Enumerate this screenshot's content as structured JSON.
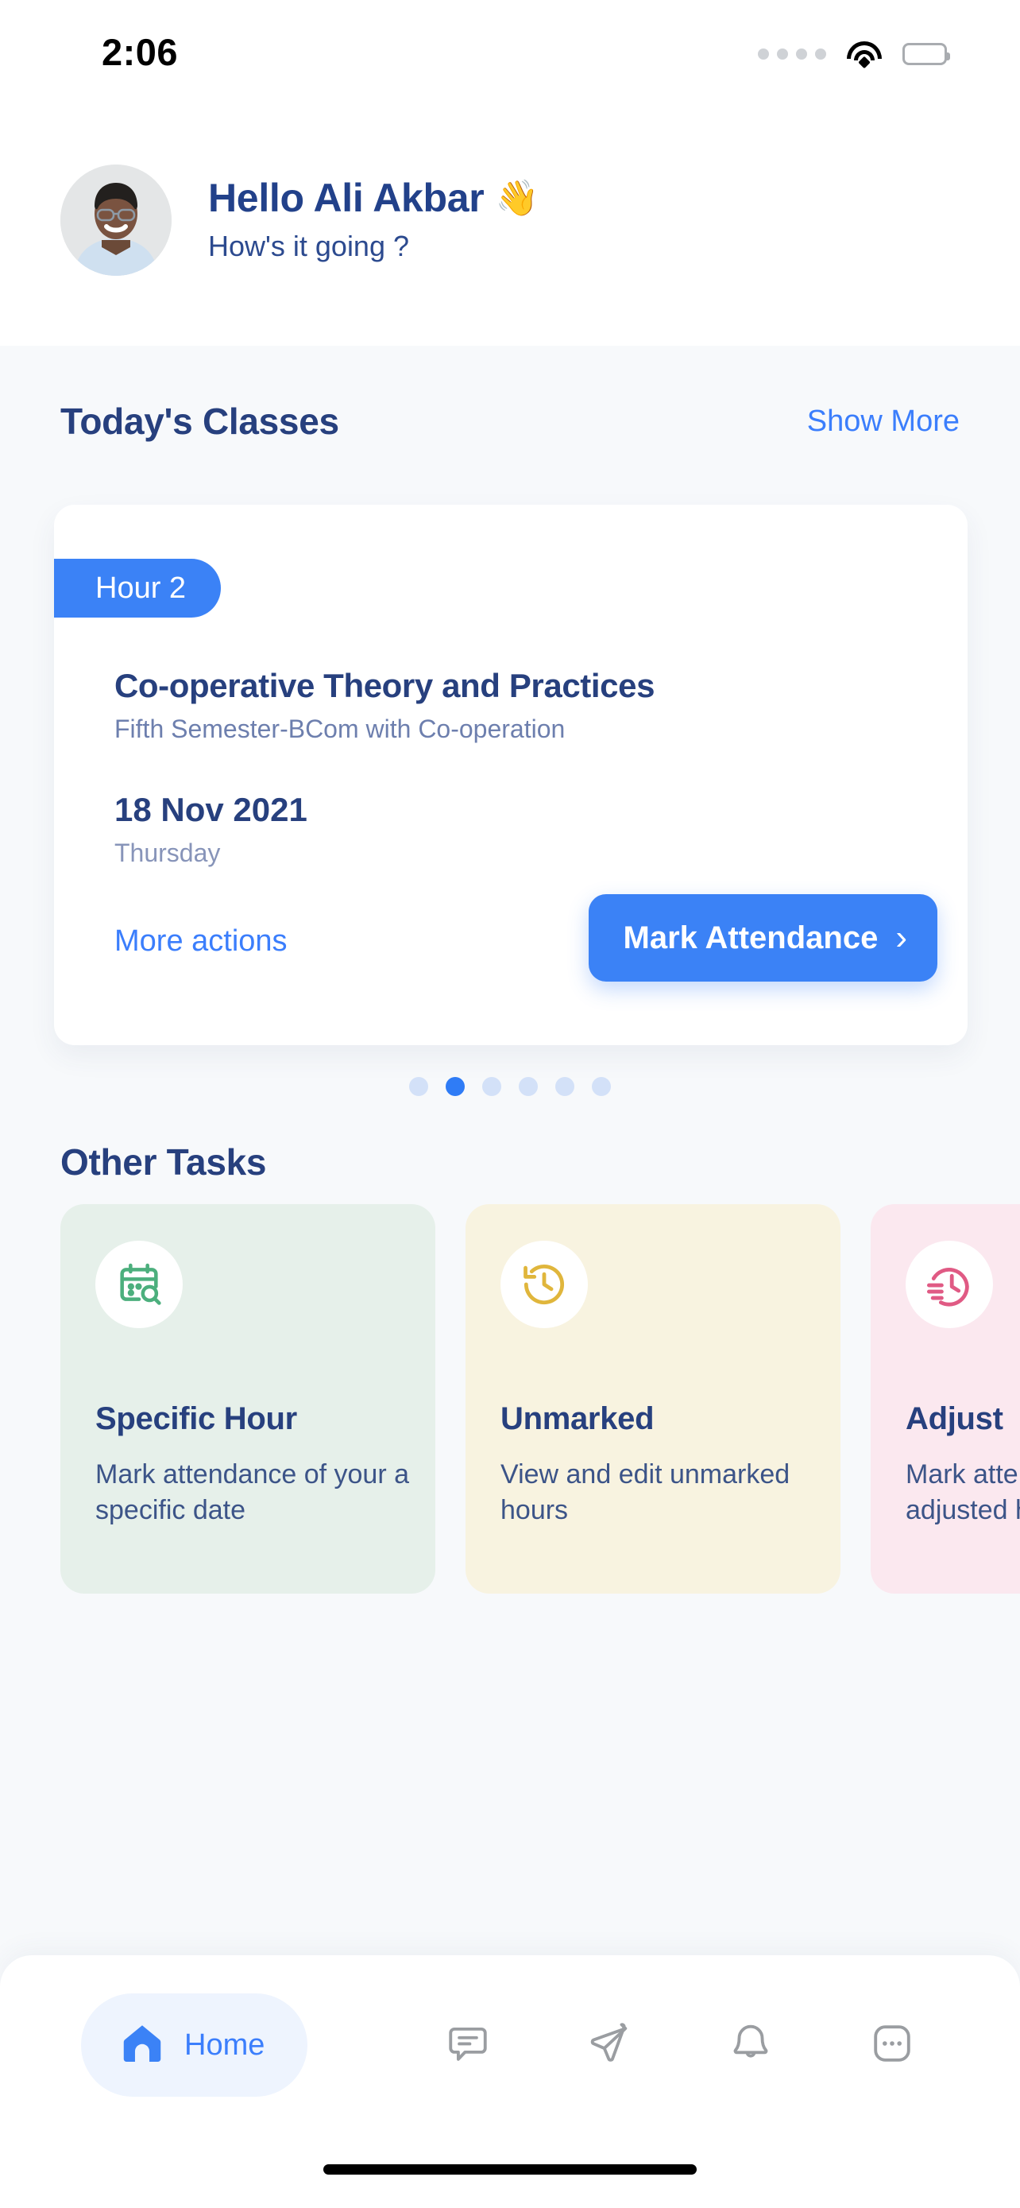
{
  "statusbar": {
    "time": "2:06",
    "signal_icon": "signal-dots-icon",
    "wifi_icon": "wifi-icon",
    "battery_icon": "battery-full-icon"
  },
  "header": {
    "avatar": "user-avatar",
    "greeting": "Hello Ali Akbar",
    "wave_emoji": "👋",
    "subtitle": "How's it going ?"
  },
  "todays_classes": {
    "title": "Today's Classes",
    "show_more": "Show More",
    "card": {
      "hour_badge": "Hour 2",
      "course_title": "Co-operative Theory and Practices",
      "course_sub": "Fifth Semester-BCom with Co-operation",
      "date": "18 Nov 2021",
      "weekday": "Thursday",
      "more_actions": "More actions",
      "primary_button": "Mark Attendance",
      "primary_button_chevron": "›"
    },
    "pager": {
      "total": 6,
      "active_index": 1
    }
  },
  "other_tasks": {
    "title": "Other Tasks",
    "cards": [
      {
        "name": "Specific Hour",
        "desc": "Mark attendance of your a specific date",
        "icon": "calendar-search-icon",
        "bg": "#e6f0ea",
        "icon_color": "#4caf7d"
      },
      {
        "name": "Unmarked",
        "desc": "View and edit unmarked hours",
        "icon": "clock-history-icon",
        "bg": "#f8f3e0",
        "icon_color": "#e0b63c"
      },
      {
        "name": "Adjust",
        "desc": "Mark attendance of your adjusted hours",
        "icon": "clock-lines-icon",
        "bg": "#fbe8ef",
        "icon_color": "#e05a84"
      }
    ]
  },
  "bottom_nav": {
    "items": [
      {
        "label": "Home",
        "icon": "home-icon",
        "active": true
      },
      {
        "label": "",
        "icon": "chat-bubble-icon",
        "active": false
      },
      {
        "label": "",
        "icon": "paper-plane-icon",
        "active": false
      },
      {
        "label": "",
        "icon": "bell-icon",
        "active": false
      },
      {
        "label": "",
        "icon": "more-dots-icon",
        "active": false
      }
    ]
  },
  "colors": {
    "accent_blue": "#3b82f6",
    "link_blue": "#3b7efc",
    "navy": "#27407e",
    "page_bg": "#f7f9fb"
  }
}
